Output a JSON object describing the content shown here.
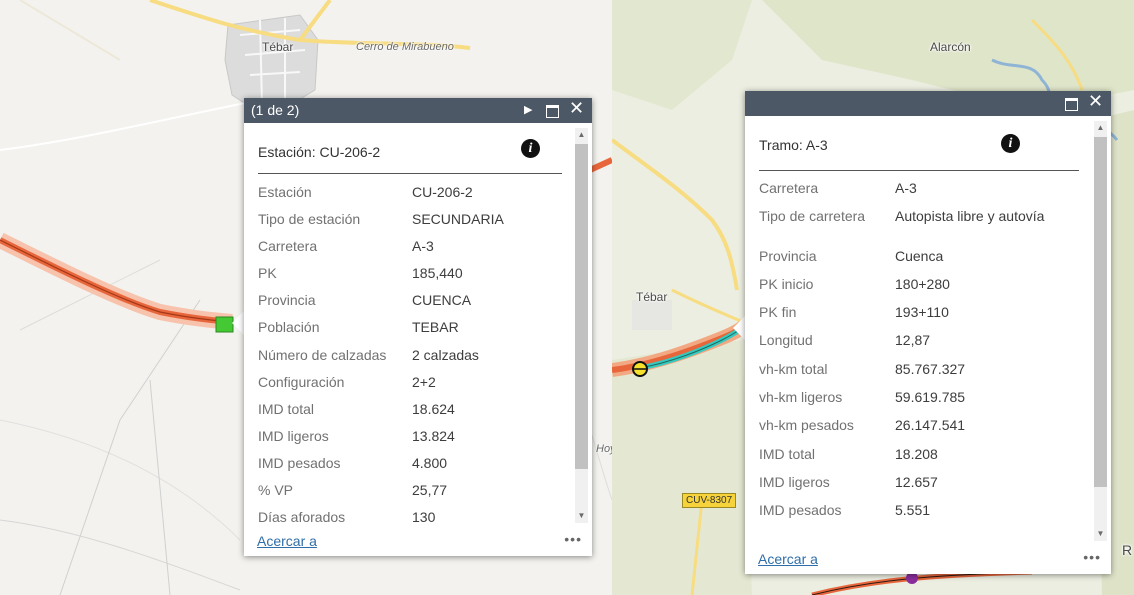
{
  "left": {
    "map_labels": {
      "town": "Tébar",
      "hill": "Cerro de Mirabueno",
      "partial_place": "Hoy"
    },
    "popup": {
      "pager": "(1 de 2)",
      "next_icon": "play-icon",
      "maximize_icon": "maximize-icon",
      "close_icon": "close-icon",
      "title": "Estación: CU-206-2",
      "info_icon": "info-icon",
      "rows": [
        {
          "key": "Estación",
          "value": "CU-206-2"
        },
        {
          "key": "Tipo de estación",
          "value": "SECUNDARIA"
        },
        {
          "key": "Carretera",
          "value": "A-3"
        },
        {
          "key": "PK",
          "value": "185,440"
        },
        {
          "key": "Provincia",
          "value": "CUENCA"
        },
        {
          "key": "Población",
          "value": "TEBAR"
        },
        {
          "key": "Número de calzadas",
          "value": "2 calzadas"
        },
        {
          "key": "Configuración",
          "value": "2+2"
        },
        {
          "key": "IMD total",
          "value": "18.624"
        },
        {
          "key": "IMD ligeros",
          "value": "13.824"
        },
        {
          "key": "IMD pesados",
          "value": "4.800"
        },
        {
          "key": "% VP",
          "value": "25,77"
        },
        {
          "key": "Días aforados",
          "value": "130"
        }
      ],
      "zoom_link": "Acercar a",
      "more_label": "•••"
    }
  },
  "right": {
    "map_labels": {
      "town_north": "Alarcón",
      "town": "Tébar",
      "road_shield": "CUV-8307",
      "partial_letter": "R"
    },
    "popup": {
      "maximize_icon": "maximize-icon",
      "close_icon": "close-icon",
      "title": "Tramo: A-3",
      "info_icon": "info-icon",
      "rows": [
        {
          "key": "Carretera",
          "value": "A-3"
        },
        {
          "key": "Tipo de carretera",
          "value": "Autopista libre y autovía"
        },
        {
          "key": "Provincia",
          "value": "Cuenca"
        },
        {
          "key": "PK inicio",
          "value": "180+280"
        },
        {
          "key": "PK fin",
          "value": "193+110"
        },
        {
          "key": "Longitud",
          "value": "12,87"
        },
        {
          "key": "vh-km total",
          "value": "85.767.327"
        },
        {
          "key": "vh-km ligeros",
          "value": "59.619.785"
        },
        {
          "key": "vh-km pesados",
          "value": "26.147.541"
        },
        {
          "key": "IMD total",
          "value": "18.208"
        },
        {
          "key": "IMD ligeros",
          "value": "12.657"
        },
        {
          "key": "IMD pesados",
          "value": "5.551"
        }
      ],
      "zoom_link": "Acercar a",
      "more_label": "•••"
    }
  },
  "colors": {
    "popup_header": "#4d5866",
    "link": "#2f6ea8",
    "highway": "#e8663c",
    "selected_segment": "#35c9c0",
    "station_marker": "#44c833"
  }
}
